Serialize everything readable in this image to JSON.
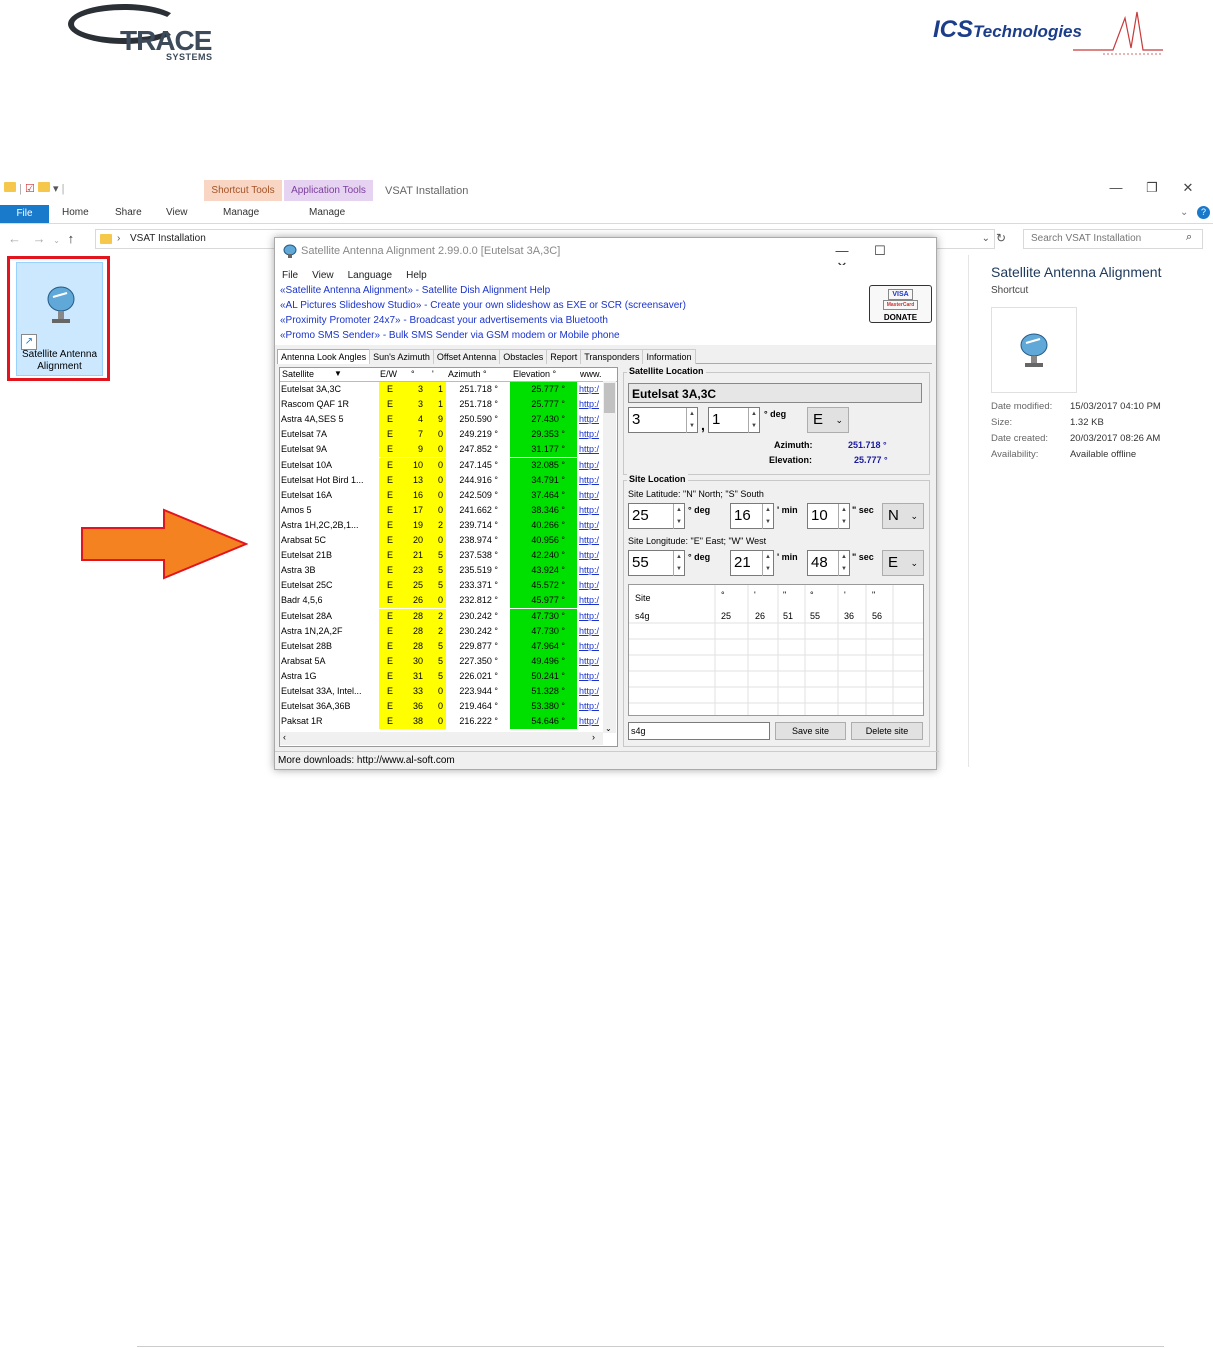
{
  "logos": {
    "trace": "TRACE",
    "trace_sub": "SYSTEMS",
    "ics": "ICS",
    "ics_rest": "Technologies"
  },
  "explorer": {
    "context_tab_shortcut": "Shortcut Tools",
    "context_tab_app": "Application Tools",
    "window_title": "VSAT Installation",
    "ribbon_tabs": [
      "File",
      "Home",
      "Share",
      "View",
      "Manage",
      "Manage"
    ],
    "address_path": "VSAT Installation",
    "search_placeholder": "Search VSAT Installation",
    "desktop_icon_label": "Satellite Antenna Alignment"
  },
  "details": {
    "title": "Satellite Antenna Alignment",
    "type": "Shortcut",
    "rows": [
      {
        "k": "Date modified:",
        "v": "15/03/2017 04:10 PM"
      },
      {
        "k": "Size:",
        "v": "1.32 KB"
      },
      {
        "k": "Date created:",
        "v": "20/03/2017 08:26 AM"
      },
      {
        "k": "Availability:",
        "v": "Available offline"
      }
    ]
  },
  "app": {
    "title": "Satellite Antenna Alignment 2.99.0.0 [Eutelsat 3A,3C]",
    "menu": [
      "File",
      "View",
      "Language",
      "Help"
    ],
    "promo": [
      "«Satellite Antenna Alignment» - Satellite Dish Alignment Help",
      "«AL Pictures Slideshow Studio» - Create your own slideshow as EXE or SCR (screensaver)",
      "«Proximity Promoter 24x7» - Broadcast your advertisements via Bluetooth",
      "«Promo SMS Sender» - Bulk SMS Sender via GSM modem or Mobile phone"
    ],
    "donate": {
      "cards": [
        "VISA",
        "MasterCard"
      ],
      "label": "DONATE"
    },
    "tabs": [
      "Antenna Look Angles",
      "Sun's Azimuth",
      "Offset Antenna",
      "Obstacles",
      "Report",
      "Transponders",
      "Information"
    ],
    "grid": {
      "headers": [
        "Satellite",
        "E/W",
        "°",
        "'",
        "Azimuth °",
        "Elevation °",
        "www."
      ],
      "rows": [
        [
          "Eutelsat 3A,3C",
          "E",
          "3",
          "1",
          "251.718 °",
          "25.777 °",
          "http:/"
        ],
        [
          "Rascom QAF 1R",
          "E",
          "3",
          "1",
          "251.718 °",
          "25.777 °",
          "http:/"
        ],
        [
          "Astra 4A,SES 5",
          "E",
          "4",
          "9",
          "250.590 °",
          "27.430 °",
          "http:/"
        ],
        [
          "Eutelsat 7A",
          "E",
          "7",
          "0",
          "249.219 °",
          "29.353 °",
          "http:/"
        ],
        [
          "Eutelsat 9A",
          "E",
          "9",
          "0",
          "247.852 °",
          "31.177 °",
          "http:/"
        ],
        [
          "Eutelsat 10A",
          "E",
          "10",
          "0",
          "247.145 °",
          "32.085 °",
          "http:/"
        ],
        [
          "Eutelsat Hot Bird 1...",
          "E",
          "13",
          "0",
          "244.916 °",
          "34.791 °",
          "http:/"
        ],
        [
          "Eutelsat 16A",
          "E",
          "16",
          "0",
          "242.509 °",
          "37.464 °",
          "http:/"
        ],
        [
          "Amos 5",
          "E",
          "17",
          "0",
          "241.662 °",
          "38.346 °",
          "http:/"
        ],
        [
          "Astra 1H,2C,2B,1...",
          "E",
          "19",
          "2",
          "239.714 °",
          "40.266 °",
          "http:/"
        ],
        [
          "Arabsat 5C",
          "E",
          "20",
          "0",
          "238.974 °",
          "40.956 °",
          "http:/"
        ],
        [
          "Eutelsat 21B",
          "E",
          "21",
          "5",
          "237.538 °",
          "42.240 °",
          "http:/"
        ],
        [
          "Astra 3B",
          "E",
          "23",
          "5",
          "235.519 °",
          "43.924 °",
          "http:/"
        ],
        [
          "Eutelsat 25C",
          "E",
          "25",
          "5",
          "233.371 °",
          "45.572 °",
          "http:/"
        ],
        [
          "Badr 4,5,6",
          "E",
          "26",
          "0",
          "232.812 °",
          "45.977 °",
          "http:/"
        ],
        [
          "Eutelsat 28A",
          "E",
          "28",
          "2",
          "230.242 °",
          "47.730 °",
          "http:/"
        ],
        [
          "Astra 1N,2A,2F",
          "E",
          "28",
          "2",
          "230.242 °",
          "47.730 °",
          "http:/"
        ],
        [
          "Eutelsat 28B",
          "E",
          "28",
          "5",
          "229.877 °",
          "47.964 °",
          "http:/"
        ],
        [
          "Arabsat 5A",
          "E",
          "30",
          "5",
          "227.350 °",
          "49.496 °",
          "http:/"
        ],
        [
          "Astra 1G",
          "E",
          "31",
          "5",
          "226.021 °",
          "50.241 °",
          "http:/"
        ],
        [
          "Eutelsat 33A, Intel...",
          "E",
          "33",
          "0",
          "223.944 °",
          "51.328 °",
          "http:/"
        ],
        [
          "Eutelsat 36A,36B",
          "E",
          "36",
          "0",
          "219.464 °",
          "53.380 °",
          "http:/"
        ],
        [
          "Paksat 1R",
          "E",
          "38",
          "0",
          "216.222 °",
          "54.646 °",
          "http:/"
        ]
      ]
    },
    "sat_location": {
      "group_label": "Satellite Location",
      "name": "Eutelsat 3A,3C",
      "deg": "3",
      "min": "1",
      "deg_label": "° deg",
      "sep": ",",
      "dir": "E",
      "azimuth_label": "Azimuth:",
      "azimuth": "251.718 °",
      "elevation_label": "Elevation:",
      "elevation": "25.777 °"
    },
    "site_location": {
      "group_label": "Site Location",
      "lat_label": "Site Latitude:  \"N\" North; \"S\" South",
      "lat": {
        "deg": "25",
        "min": "16",
        "sec": "10",
        "dir": "N"
      },
      "lon_label": "Site Longitude:  \"E\" East; \"W\" West",
      "lon": {
        "deg": "55",
        "min": "21",
        "sec": "48",
        "dir": "E"
      },
      "deg_label": "° deg",
      "min_label": "' min",
      "sec_label": "\" sec",
      "sites_headers": [
        "Site",
        "°",
        "'",
        "\"",
        "°",
        "'",
        "\""
      ],
      "sites_rows": [
        [
          "s4g",
          "25",
          "26",
          "51",
          "55",
          "36",
          "56"
        ]
      ],
      "site_name_value": "s4g",
      "save_label": "Save site",
      "delete_label": "Delete site"
    },
    "status": "More downloads: http://www.al-soft.com"
  }
}
